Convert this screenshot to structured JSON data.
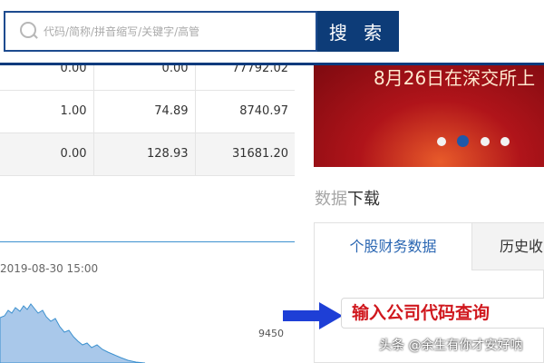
{
  "search": {
    "placeholder": "代码/简称/拼音缩写/关键字/高管",
    "button_label": "搜 索"
  },
  "table": {
    "rows": [
      [
        "0.00",
        "0.00",
        "77792.02"
      ],
      [
        "1.00",
        "74.89",
        "8740.97"
      ],
      [
        "0.00",
        "128.93",
        "31681.20"
      ]
    ]
  },
  "chart": {
    "date_label": "2019-08-30 15:00",
    "y_tick": "9450",
    "line_color": "#3d91cf",
    "fill_color": "#a9c8ea"
  },
  "banner": {
    "text": "8月26日在深交所上",
    "dots_count": 4,
    "active_dot": 1
  },
  "data_section": {
    "title_light": "数据",
    "title_dark": "下载",
    "tabs": [
      {
        "label": "个股财务数据",
        "active": true
      },
      {
        "label": "历史收",
        "active": false
      }
    ]
  },
  "annotation": {
    "text": "输入公司代码查询",
    "arrow_color": "#1e3fd6"
  },
  "watermark": {
    "text": "头条 @余生有你才安好呐"
  },
  "colors": {
    "accent": "#0d3c78",
    "link_blue": "#2a66b2",
    "banner_red": "#b0141a",
    "annotation_red": "#d0181e"
  }
}
